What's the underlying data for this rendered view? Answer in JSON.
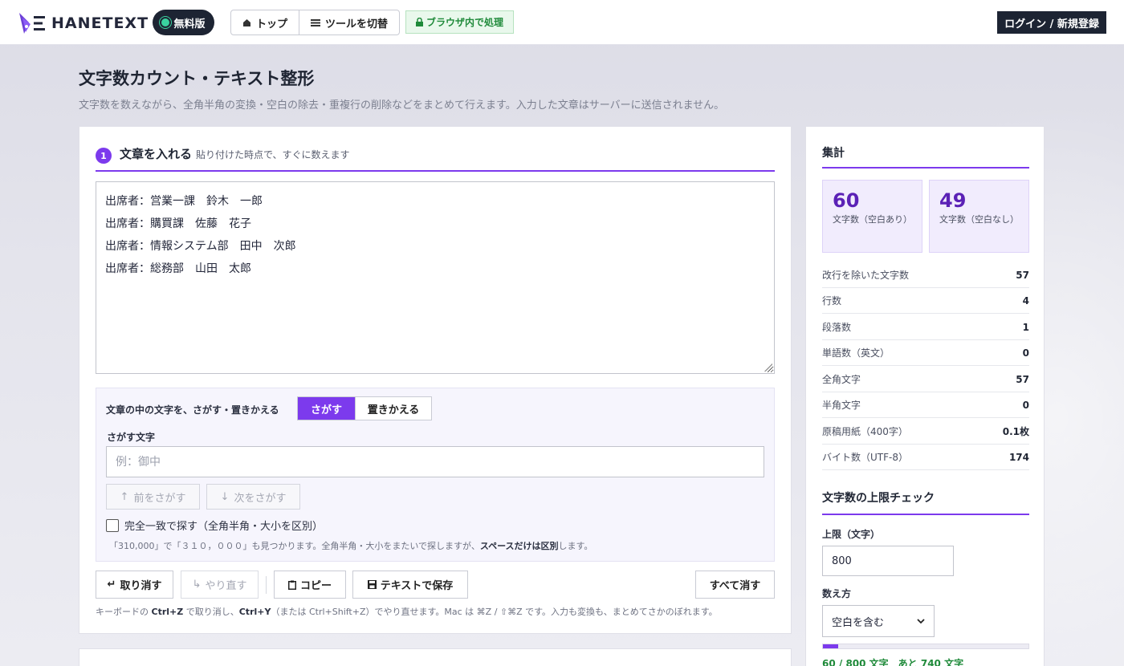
{
  "header": {
    "logo_text": "HANETEXT",
    "free_badge": "無料版",
    "nav": [
      {
        "label": "トップ",
        "icon": "home-icon"
      },
      {
        "label": "ツールを切替",
        "icon": "menu-icon"
      }
    ],
    "browser_chip": "ブラウザ内で処理",
    "login_button": "ログイン / 新規登録"
  },
  "page": {
    "title": "文字数カウント・テキスト整形",
    "description": "文字数を数えながら、全角半角の変換・空白の除去・重複行の削除などをまとめて行えます。入力した文章はサーバーに送信されません。"
  },
  "input_section": {
    "step_number": "1",
    "title": "文章を入れる",
    "subtitle": "貼り付けた時点で、すぐに数えます",
    "lines": [
      "出席者：営業一課　鈴木　一郎",
      "出席者：購買課　佐藤　花子",
      "出席者：情報システム部　田中　次郎",
      "出席者：総務部　山田　太郎"
    ]
  },
  "search_panel": {
    "label": "文章の中の文字を、さがす・置きかえる",
    "mode_search": "さがす",
    "mode_replace": "置きかえる",
    "field_label": "さがす文字",
    "placeholder": "例：御中",
    "prev_button": "前をさがす",
    "next_button": "次をさがす",
    "exact_match_label": "完全一致で探す（全角半角・大小を区別）",
    "note_prefix": "「310,000」で「３１０，０００」も見つかります。全角半角・大小をまたいで探しますが、",
    "note_bold": "スペースだけは区別",
    "note_suffix": "します。"
  },
  "actions": {
    "undo": "取り消す",
    "redo": "やり直す",
    "copy": "コピー",
    "save": "テキストで保存",
    "clear_all": "すべて消す"
  },
  "keyboard_note": {
    "p1": "キーボードの ",
    "k1": "Ctrl+Z",
    "p2": " で取り消し、",
    "k2": "Ctrl+Y",
    "p3": "（または Ctrl+Shift+Z）でやり直せます。Mac は ⌘Z / ⇧⌘Z です。入力も変換も、まとめてさかのぼれます。"
  },
  "summary": {
    "title": "集計",
    "with_spaces": {
      "value": "60",
      "label": "文字数（空白あり）"
    },
    "without_spaces": {
      "value": "49",
      "label": "文字数（空白なし）"
    },
    "rows": [
      {
        "label": "改行を除いた文字数",
        "value": "57"
      },
      {
        "label": "行数",
        "value": "4"
      },
      {
        "label": "段落数",
        "value": "1"
      },
      {
        "label": "単語数（英文）",
        "value": "0"
      },
      {
        "label": "全角文字",
        "value": "57"
      },
      {
        "label": "半角文字",
        "value": "0"
      },
      {
        "label": "原稿用紙（400字）",
        "value": "0.1枚"
      },
      {
        "label": "バイト数（UTF-8）",
        "value": "174"
      }
    ]
  },
  "limit_check": {
    "title": "文字数の上限チェック",
    "limit_label": "上限（文字）",
    "limit_value": "800",
    "count_mode_label": "数え方",
    "count_mode_value": "空白を含む",
    "progress_fraction": 0.075,
    "progress_text": "60 / 800 文字　あと 740 文字"
  },
  "colors": {
    "accent": "#7c3aed",
    "dark": "#1d2433",
    "success": "#1f8a3a"
  }
}
